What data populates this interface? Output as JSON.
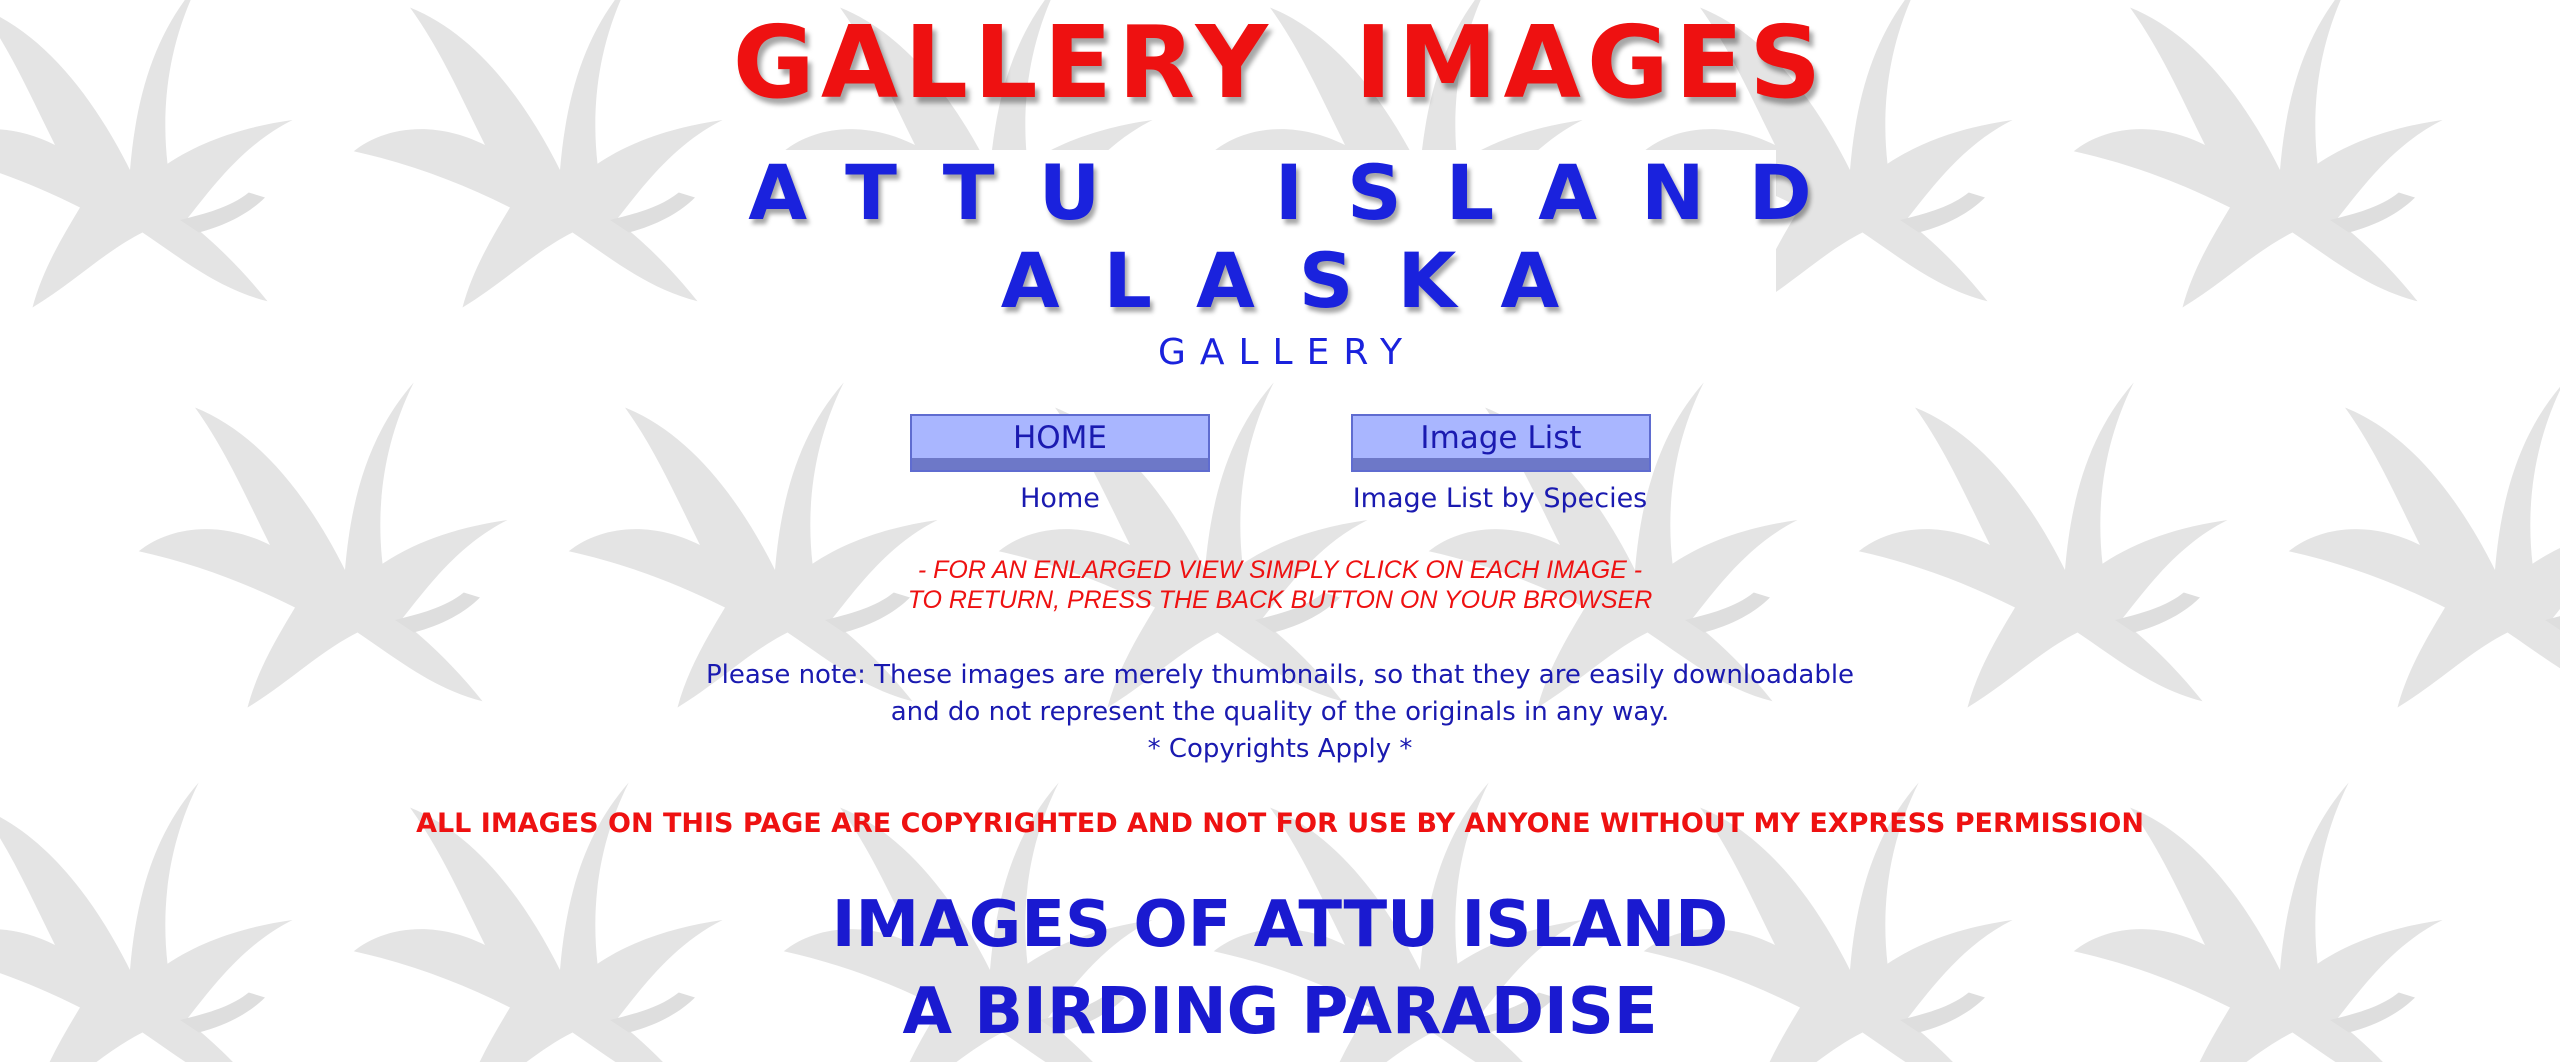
{
  "header": {
    "gallery_title": "GALLERY  IMAGES",
    "banner_line_1": "ATTU ISLAND",
    "banner_line_2": "ALASKA",
    "banner_sub": "GALLERY"
  },
  "nav": {
    "home_button": "HOME",
    "image_list_button": "Image List",
    "home_link": "Home",
    "image_list_link": "Image List by Species"
  },
  "notes": {
    "enlarge_line_1": "- FOR AN ENLARGED VIEW SIMPLY CLICK ON EACH IMAGE -",
    "enlarge_line_2": "TO RETURN, PRESS THE BACK BUTTON ON YOUR BROWSER",
    "thumbnail_line_1": "Please note: These images are merely thumbnails, so that they are easily downloadable",
    "thumbnail_line_2": "and do not represent the quality of the originals in any way.",
    "copyright_line": "* Copyrights Apply *",
    "copyright_warning": "ALL IMAGES ON THIS PAGE ARE COPYRIGHTED AND NOT FOR USE BY ANYONE WITHOUT MY EXPRESS PERMISSION"
  },
  "main": {
    "heading_line_1": "IMAGES OF ATTU ISLAND",
    "heading_line_2": "A BIRDING PARADISE"
  },
  "colors": {
    "title_red": "#ee1111",
    "banner_blue": "#1a22dd",
    "text_blue": "#1a1ab0",
    "button_fill": "#a9b6ff",
    "background_watermark": "#e6e6e6"
  },
  "icons": {
    "background": "flying-bird-watermark-icon"
  }
}
